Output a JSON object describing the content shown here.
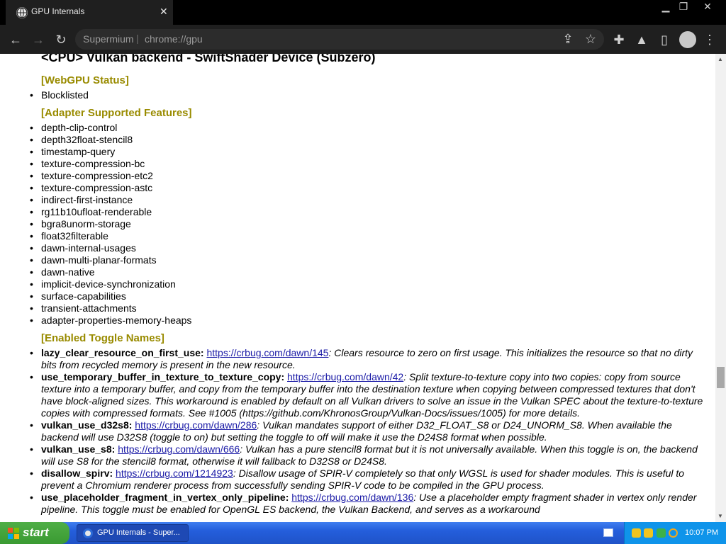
{
  "tab": {
    "title": "GPU Internals",
    "close_glyph": "✕"
  },
  "window_controls": {
    "minimize": "▁",
    "restore": "❐",
    "close": "✕"
  },
  "toolbar": {
    "back_glyph": "←",
    "forward_glyph": "→",
    "reload_glyph": "↻",
    "omnibox_site": "Supermium",
    "omnibox_separator": "|",
    "omnibox_url": "chrome://gpu",
    "share_glyph": "⇪",
    "star_glyph": "☆",
    "extensions_glyph": "✚",
    "labs_glyph": "▲",
    "sidepanel_glyph": "▯",
    "menu_glyph": "⋮"
  },
  "content": {
    "adapter_title": "<CPU> Vulkan backend - SwiftShader Device (Subzero)",
    "webgpu_status_heading": "[WebGPU Status]",
    "webgpu_status": [
      "Blocklisted"
    ],
    "features_heading": "[Adapter Supported Features]",
    "features": [
      "depth-clip-control",
      "depth32float-stencil8",
      "timestamp-query",
      "texture-compression-bc",
      "texture-compression-etc2",
      "texture-compression-astc",
      "indirect-first-instance",
      "rg11b10ufloat-renderable",
      "bgra8unorm-storage",
      "float32filterable",
      "dawn-internal-usages",
      "dawn-multi-planar-formats",
      "dawn-native",
      "implicit-device-synchronization",
      "surface-capabilities",
      "transient-attachments",
      "adapter-properties-memory-heaps"
    ],
    "toggles_heading": "[Enabled Toggle Names]",
    "toggles": [
      {
        "name": "lazy_clear_resource_on_first_use:",
        "link": "https://crbug.com/dawn/145",
        "desc": ": Clears resource to zero on first usage. This initializes the resource so that no dirty bits from recycled memory is present in the new resource."
      },
      {
        "name": "use_temporary_buffer_in_texture_to_texture_copy:",
        "link": "https://crbug.com/dawn/42",
        "desc": ": Split texture-to-texture copy into two copies: copy from source texture into a temporary buffer, and copy from the temporary buffer into the destination texture when copying between compressed textures that don't have block-aligned sizes. This workaround is enabled by default on all Vulkan drivers to solve an issue in the Vulkan SPEC about the texture-to-texture copies with compressed formats. See #1005 (https://github.com/KhronosGroup/Vulkan-Docs/issues/1005) for more details."
      },
      {
        "name": "vulkan_use_d32s8:",
        "link": "https://crbug.com/dawn/286",
        "desc": ": Vulkan mandates support of either D32_FLOAT_S8 or D24_UNORM_S8. When available the backend will use D32S8 (toggle to on) but setting the toggle to off will make it use the D24S8 format when possible."
      },
      {
        "name": "vulkan_use_s8:",
        "link": "https://crbug.com/dawn/666",
        "desc": ": Vulkan has a pure stencil8 format but it is not universally available. When this toggle is on, the backend will use S8 for the stencil8 format, otherwise it will fallback to D32S8 or D24S8."
      },
      {
        "name": "disallow_spirv:",
        "link": "https://crbug.com/1214923",
        "desc": ": Disallow usage of SPIR-V completely so that only WGSL is used for shader modules. This is useful to prevent a Chromium renderer process from successfully sending SPIR-V code to be compiled in the GPU process."
      },
      {
        "name": "use_placeholder_fragment_in_vertex_only_pipeline:",
        "link": "https://crbug.com/dawn/136",
        "desc": ": Use a placeholder empty fragment shader in vertex only render pipeline. This toggle must be enabled for OpenGL ES backend, the Vulkan Backend, and serves as a workaround"
      }
    ]
  },
  "scrollbar": {
    "up_glyph": "▲",
    "down_glyph": "▼"
  },
  "taskbar": {
    "start_label": "start",
    "task_label": "GPU Internals - Super...",
    "clock": "10:07 PM"
  }
}
